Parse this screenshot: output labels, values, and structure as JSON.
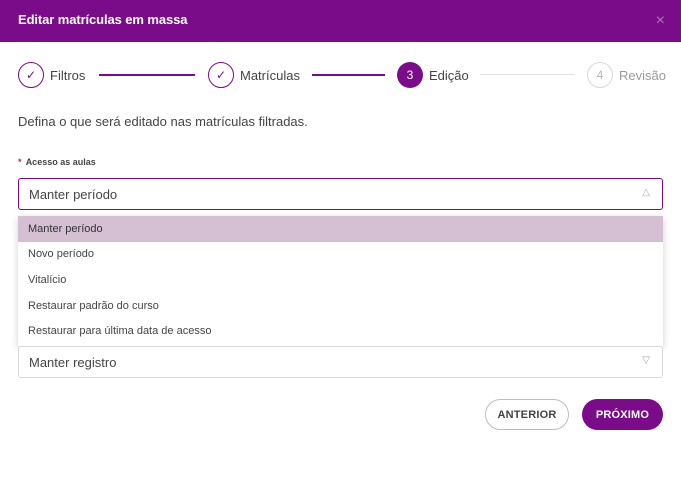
{
  "dialog": {
    "title": "Editar matrículas em massa",
    "close_symbol": "×"
  },
  "stepper": {
    "steps": [
      {
        "label": "Filtros",
        "state": "done",
        "marker": "✓"
      },
      {
        "label": "Matrículas",
        "state": "done",
        "marker": "✓"
      },
      {
        "label": "Edição",
        "state": "active",
        "marker": "3"
      },
      {
        "label": "Revisão",
        "state": "pending",
        "marker": "4"
      }
    ]
  },
  "description": "Defina o que será editado nas matrículas filtradas.",
  "access_field": {
    "required_mark": "*",
    "label": "Acesso as aulas",
    "value": "Manter período",
    "options": [
      "Manter período",
      "Novo período",
      "Vitalício",
      "Restaurar padrão do curso",
      "Restaurar para última data de acesso"
    ],
    "selected_index": 0
  },
  "registration_field": {
    "value": "Manter registro"
  },
  "buttons": {
    "back": "ANTERIOR",
    "next": "PRÓXIMO"
  },
  "colors": {
    "primary": "#7a0b89",
    "selected_option": "#d4bfd3",
    "required": "#d9252a"
  }
}
